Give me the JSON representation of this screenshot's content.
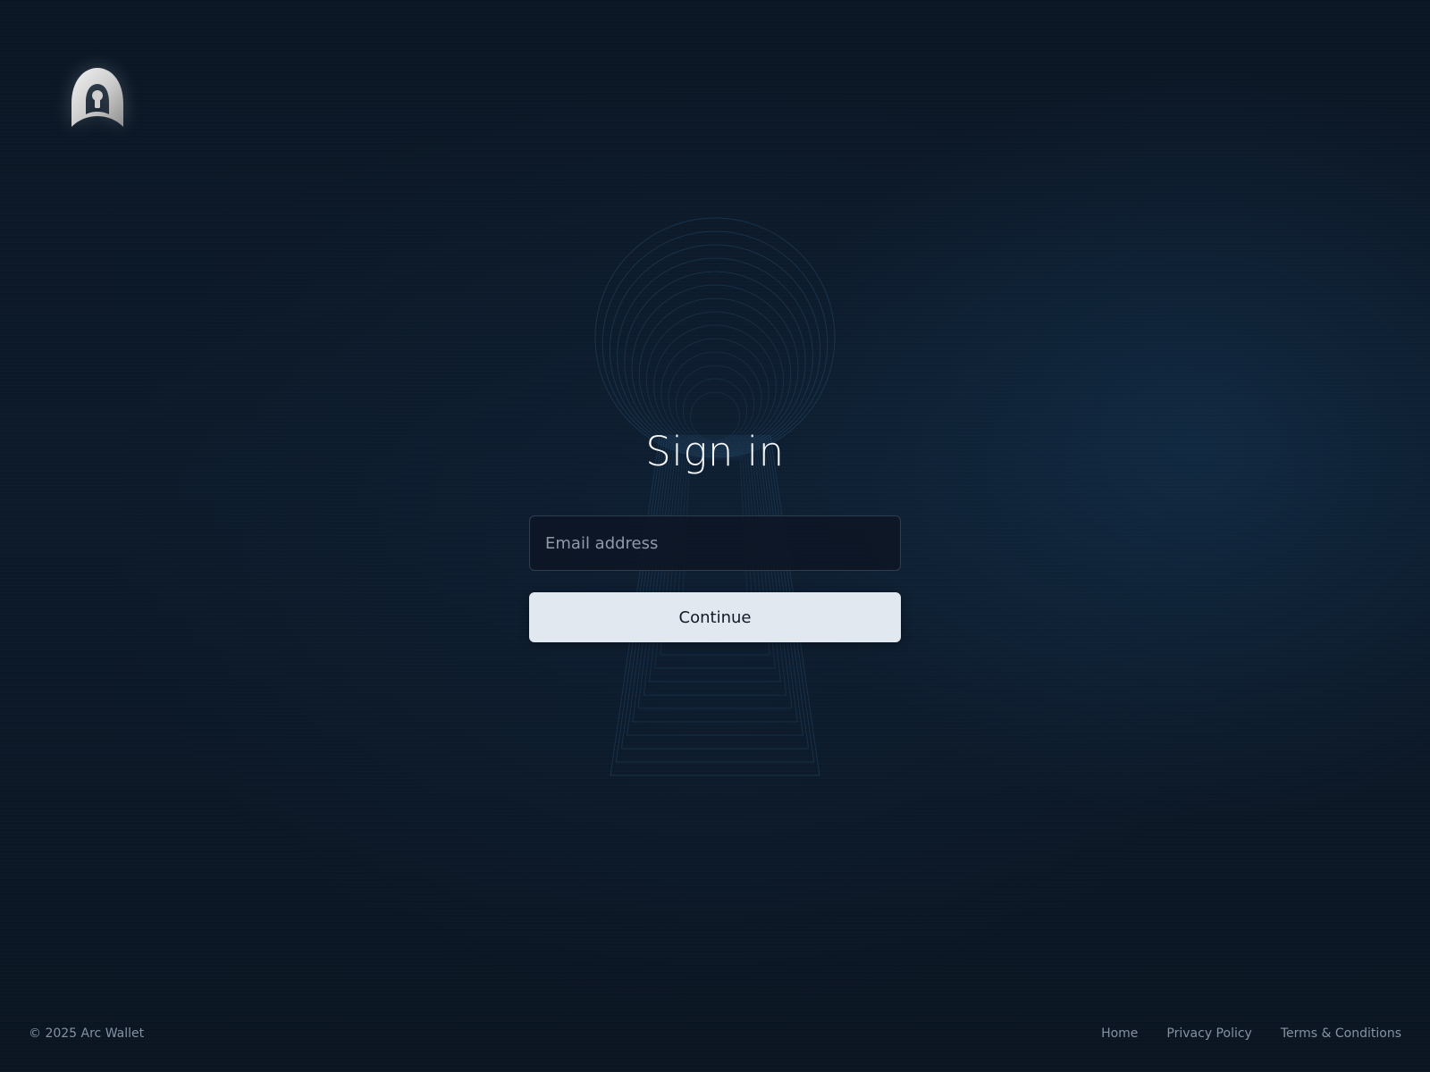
{
  "brand": {
    "logo_icon": "keyhole-arch-icon"
  },
  "signin": {
    "title": "Sign in",
    "email_placeholder": "Email address",
    "email_value": "",
    "continue_label": "Continue"
  },
  "footer": {
    "copyright": "© 2025 Arc Wallet",
    "links": {
      "home": "Home",
      "privacy": "Privacy Policy",
      "terms": "Terms & Conditions"
    }
  },
  "colors": {
    "background": "#0c1a2a",
    "button_bg": "#e1e8f0",
    "button_text": "#111827",
    "art_stroke": "#2f5a7e",
    "muted_text": "#8592a3"
  }
}
